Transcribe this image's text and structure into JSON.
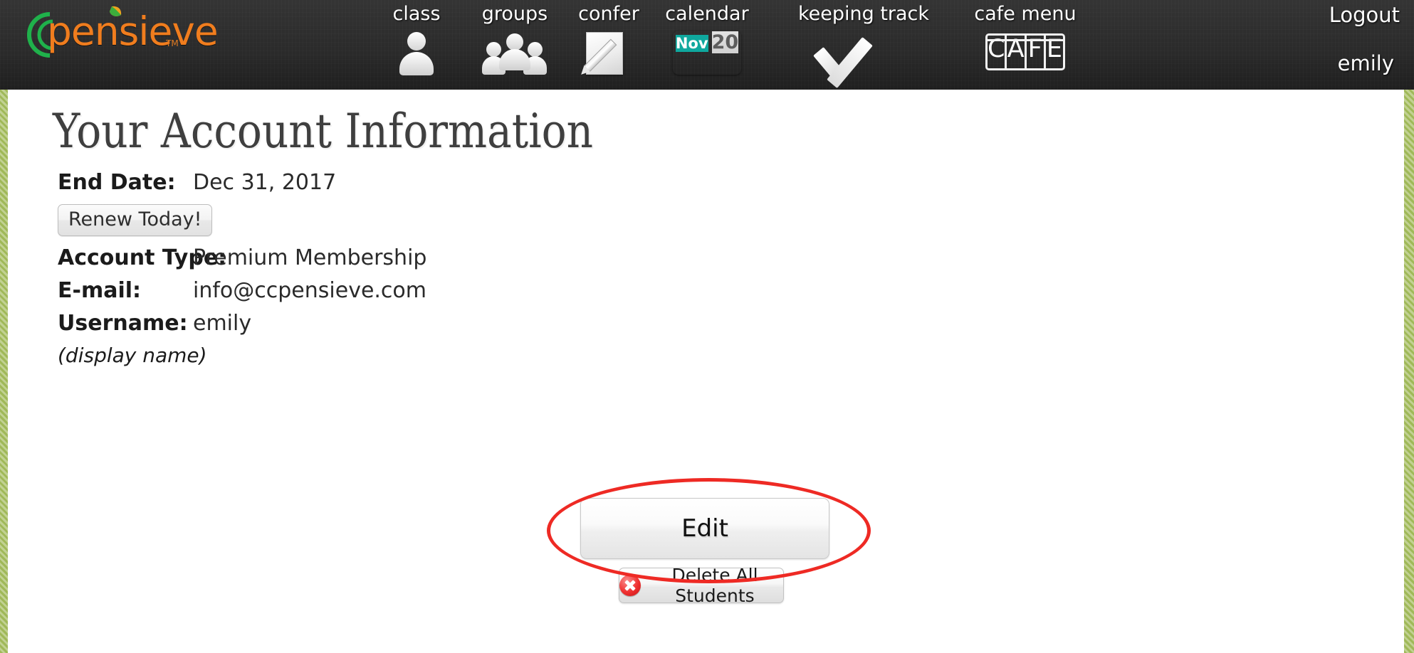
{
  "brand": {
    "wordmark": "pensieve",
    "tm": "TM",
    "logo_green": "#1fb14b",
    "logo_orange": "#f07d1e"
  },
  "topnav": {
    "items": [
      {
        "label": "class",
        "icon": "person-icon"
      },
      {
        "label": "groups",
        "icon": "people-group-icon"
      },
      {
        "label": "confer",
        "icon": "page-pencil-icon"
      },
      {
        "label": "calendar",
        "icon": "calendar-icon"
      },
      {
        "label": "keeping track",
        "icon": "checkmark-icon"
      },
      {
        "label": "cafe menu",
        "icon": "cafe-icon"
      }
    ],
    "calendar_icon": {
      "month": "Nov",
      "day": "20",
      "header_color": "#0fa89e",
      "body_color": "#d8d8d8"
    },
    "cafe_icon_letters": [
      "C",
      "A",
      "F",
      "E"
    ],
    "logout_label": "Logout",
    "username_label": "emily"
  },
  "main": {
    "page_title": "Your Account Information",
    "rows": [
      {
        "label": "End Date:",
        "value": "Dec 31, 2017"
      },
      {
        "label": "Account Type:",
        "value": "Premium Membership"
      },
      {
        "label": "E-mail:",
        "value": "info@ccpensieve.com"
      },
      {
        "label": "Username:",
        "value": "emily"
      }
    ],
    "renew_button_label": "Renew Today!",
    "display_name_note": "(display name)",
    "edit_button_label": "Edit",
    "delete_button_label": "Delete All Students",
    "delete_icon": "delete-x-icon",
    "annotation_color": "#ee2a24"
  },
  "chrome": {
    "side_border_color": "#a0b958",
    "topbar_color": "#2b2b2b"
  }
}
